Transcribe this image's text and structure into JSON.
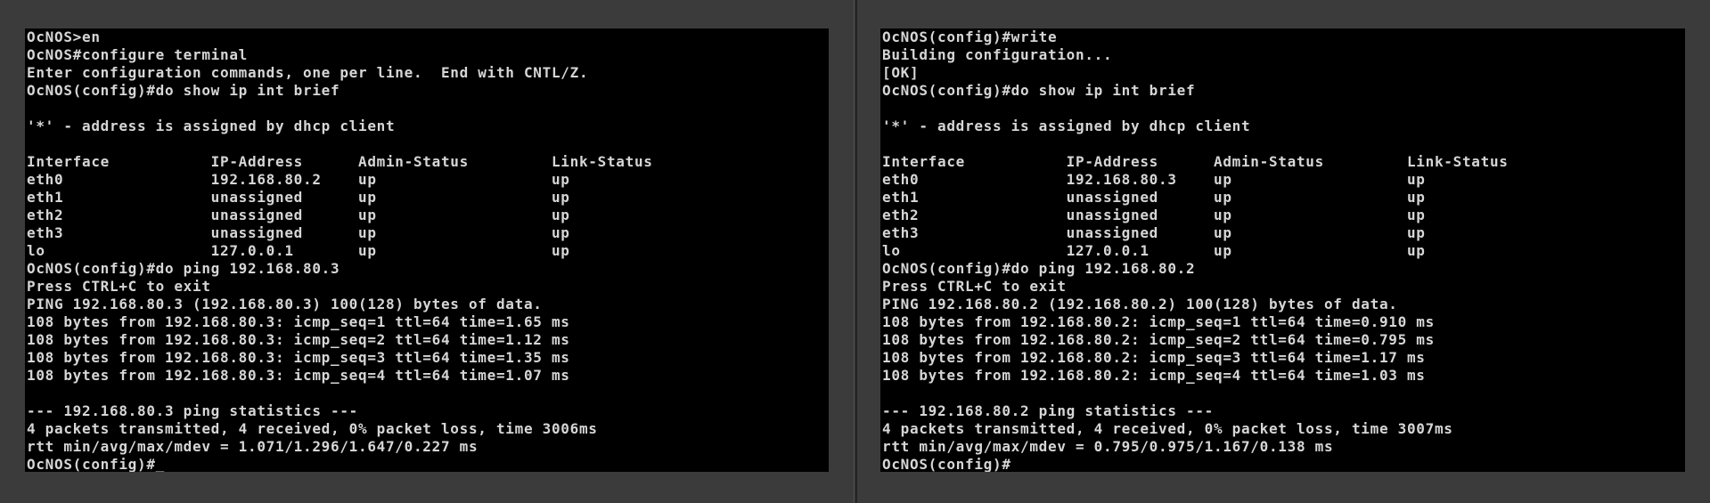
{
  "colors": {
    "desktop_bg": "#3b3b3b",
    "terminal_bg": "#000000",
    "terminal_fg": "#d6d6d6"
  },
  "left_terminal": {
    "lines": [
      "OcNOS>en",
      "OcNOS#configure terminal",
      "Enter configuration commands, one per line.  End with CNTL/Z.",
      "OcNOS(config)#do show ip int brief",
      "",
      "'*' - address is assigned by dhcp client",
      "",
      "Interface           IP-Address      Admin-Status         Link-Status",
      "eth0                192.168.80.2    up                   up",
      "eth1                unassigned      up                   up",
      "eth2                unassigned      up                   up",
      "eth3                unassigned      up                   up",
      "lo                  127.0.0.1       up                   up",
      "OcNOS(config)#do ping 192.168.80.3",
      "Press CTRL+C to exit",
      "PING 192.168.80.3 (192.168.80.3) 100(128) bytes of data.",
      "108 bytes from 192.168.80.3: icmp_seq=1 ttl=64 time=1.65 ms",
      "108 bytes from 192.168.80.3: icmp_seq=2 ttl=64 time=1.12 ms",
      "108 bytes from 192.168.80.3: icmp_seq=3 ttl=64 time=1.35 ms",
      "108 bytes from 192.168.80.3: icmp_seq=4 ttl=64 time=1.07 ms",
      "",
      "--- 192.168.80.3 ping statistics ---",
      "4 packets transmitted, 4 received, 0% packet loss, time 3006ms",
      "rtt min/avg/max/mdev = 1.071/1.296/1.647/0.227 ms",
      "OcNOS(config)#_"
    ]
  },
  "right_terminal": {
    "lines": [
      "OcNOS(config)#write",
      "Building configuration...",
      "[OK]",
      "OcNOS(config)#do show ip int brief",
      "",
      "'*' - address is assigned by dhcp client",
      "",
      "Interface           IP-Address      Admin-Status         Link-Status",
      "eth0                192.168.80.3    up                   up",
      "eth1                unassigned      up                   up",
      "eth2                unassigned      up                   up",
      "eth3                unassigned      up                   up",
      "lo                  127.0.0.1       up                   up",
      "OcNOS(config)#do ping 192.168.80.2",
      "Press CTRL+C to exit",
      "PING 192.168.80.2 (192.168.80.2) 100(128) bytes of data.",
      "108 bytes from 192.168.80.2: icmp_seq=1 ttl=64 time=0.910 ms",
      "108 bytes from 192.168.80.2: icmp_seq=2 ttl=64 time=0.795 ms",
      "108 bytes from 192.168.80.2: icmp_seq=3 ttl=64 time=1.17 ms",
      "108 bytes from 192.168.80.2: icmp_seq=4 ttl=64 time=1.03 ms",
      "",
      "--- 192.168.80.2 ping statistics ---",
      "4 packets transmitted, 4 received, 0% packet loss, time 3007ms",
      "rtt min/avg/max/mdev = 0.795/0.975/1.167/0.138 ms",
      "OcNOS(config)#"
    ]
  }
}
